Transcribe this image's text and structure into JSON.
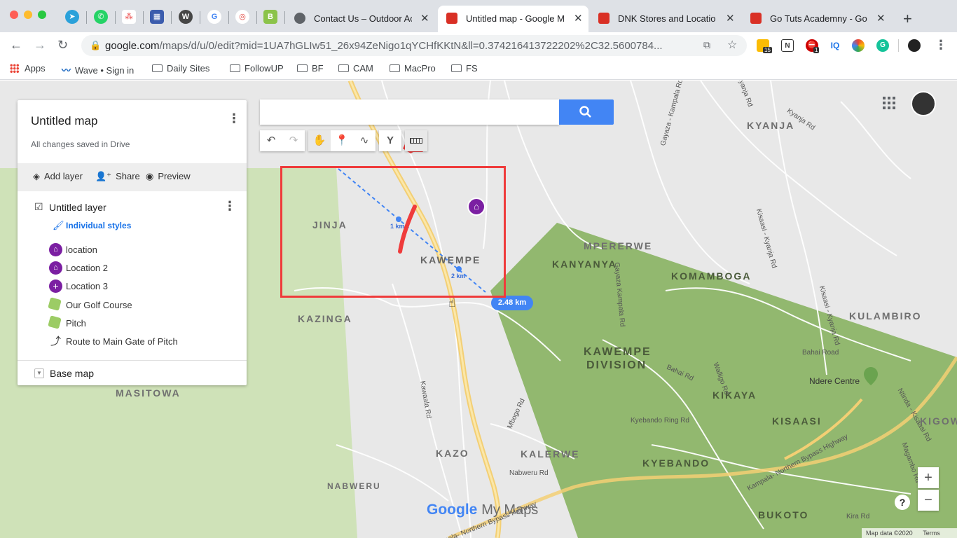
{
  "browser": {
    "tabs": [
      {
        "label": "Contact Us – Outdoor Ac",
        "favicon": "globe-icon"
      },
      {
        "label": "Untitled map - Google M",
        "favicon": "maps-pin-icon",
        "active": true
      },
      {
        "label": "DNK Stores and Locatio",
        "favicon": "maps-pin-icon"
      },
      {
        "label": "Go Tuts Academny - Go",
        "favicon": "maps-pin-icon"
      }
    ],
    "url_host": "google.com",
    "url_path": "/maps/d/u/0/edit?mid=1UA7hGLIw51_26x94ZeNigo1qYCHfKKtN&ll=0.37421641372220​2%2C32.5600784...",
    "extension_badges": {
      "first": "15",
      "abp": "1"
    },
    "extension_text": {
      "iq": "IQ"
    },
    "bookmarks": [
      {
        "label": "Apps",
        "icon": "apps-grid-icon"
      },
      {
        "label": "Wave • Sign in",
        "icon": "wave-icon"
      },
      {
        "label": "Daily Sites",
        "icon": "folder-icon"
      },
      {
        "label": "FollowUP",
        "icon": "folder-icon"
      },
      {
        "label": "BF",
        "icon": "folder-icon"
      },
      {
        "label": "CAM",
        "icon": "folder-icon"
      },
      {
        "label": "MacPro",
        "icon": "folder-icon"
      },
      {
        "label": "FS",
        "icon": "folder-icon"
      }
    ]
  },
  "panel": {
    "title": "Untitled map",
    "saved": "All changes saved in Drive",
    "actions": {
      "add_layer": "Add layer",
      "share": "Share",
      "preview": "Preview"
    },
    "layer": {
      "title": "Untitled layer",
      "style_link": "Individual styles"
    },
    "features": [
      {
        "label": "location",
        "icon": "home-pin-icon"
      },
      {
        "label": "Location 2",
        "icon": "home-pin-icon"
      },
      {
        "label": "Location 3",
        "icon": "plus-pin-icon"
      },
      {
        "label": "Our Golf Course",
        "icon": "polygon-icon"
      },
      {
        "label": "Pitch",
        "icon": "polygon-icon"
      },
      {
        "label": "Route to Main Gate of Pitch",
        "icon": "route-icon"
      }
    ],
    "base_map": "Base map"
  },
  "map": {
    "places": {
      "jinja": "JINJA",
      "kawempe": "KAWEMPE",
      "kazinga": "KAZINGA",
      "masitowa": "MASITOWA",
      "kazo": "KAZO",
      "nabweru": "NABWERU",
      "kalerwe": "KALERWE",
      "kyanja": "KYANJA",
      "mpererwe": "MPERERWE",
      "kanyanya": "KANYANYA",
      "komamboga": "KOMAMBOGA",
      "kulambiro": "KULAMBIRO",
      "kawempe_div1": "KAWEMPE",
      "kawempe_div2": "DIVISION",
      "kikaya": "KIKAYA",
      "kisaasi": "KISAASI",
      "kyebando": "KYEBANDO",
      "bukoto": "BUKOTO",
      "kigowa": "KIGOW",
      "ndere": "Ndere Centre"
    },
    "roads": {
      "kawaala": "Kawaala Rd",
      "mbogo": "Mbogo Rd",
      "nabweru": "Nabweru Rd",
      "bahai": "Bahai Road",
      "bahai2": "Bahai Rd",
      "kyebando_ring": "Kyebando Ring Rd",
      "northern_bypass": "Kampala- Northern Bypass Highway",
      "northern_bypass2": "pala- Northern Bypass Highway",
      "gayaza": "Gayaza -Kampala Rd",
      "gayaza2": "Gayaza Kampala Rd",
      "kisaasi_kyanja": "Kisaasi - Kyanja Rd",
      "kisaasi_kyanja2": "Kisaasi - Kyanja Rd",
      "kyanja": "Kyanja Rd",
      "kiira": "Kira Rd",
      "ntinda": "Ntinda - Kisaasi Rd",
      "magambo": "Magambo Rd",
      "walligo": "Walligo Rd",
      "gayaza_top": "Gayaza - Kampala Rd",
      "kyanja_top": "Kyanja Rd"
    },
    "measure": {
      "km1": "1 km",
      "km2": "2 km",
      "total": "2.48 km"
    },
    "branding": {
      "google": "Google",
      "my_maps": "My Maps"
    },
    "footer": {
      "data": "Map data ©2020",
      "terms": "Terms"
    },
    "zoom": {
      "in": "+",
      "out": "−"
    },
    "help": "?"
  },
  "colors": {
    "accent": "#4285f4",
    "pin": "#7b1fa2",
    "green_area": "#8bb36a",
    "annotation": "#ef3b3b"
  }
}
